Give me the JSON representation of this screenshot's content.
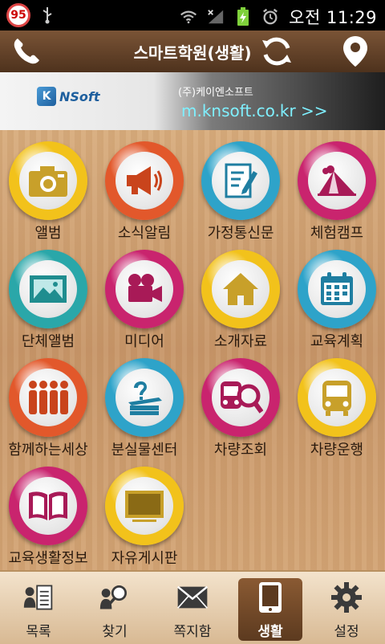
{
  "status_bar": {
    "notification_count": "95",
    "time": "오전 11:29"
  },
  "title_bar": {
    "title": "스마트학원(생활)"
  },
  "banner": {
    "logo_text": "NSoft",
    "company": "(주)케이엔소프트",
    "url": "m.knsoft.co.kr >>"
  },
  "menu": [
    {
      "label": "앨범",
      "ring": "#f2c21b",
      "icon": "camera-icon"
    },
    {
      "label": "소식알림",
      "ring": "#e2582b",
      "icon": "megaphone-icon"
    },
    {
      "label": "가정통신문",
      "ring": "#2ea3c9",
      "icon": "document-edit-icon"
    },
    {
      "label": "체험캠프",
      "ring": "#c9246e",
      "icon": "tent-icon"
    },
    {
      "label": "단체앨범",
      "ring": "#2aa7a9",
      "icon": "picture-icon"
    },
    {
      "label": "미디어",
      "ring": "#c9246e",
      "icon": "video-camera-icon"
    },
    {
      "label": "소개자료",
      "ring": "#f2c21b",
      "icon": "house-icon"
    },
    {
      "label": "교육계획",
      "ring": "#2ea3c9",
      "icon": "calendar-icon"
    },
    {
      "label": "함께하는세상",
      "ring": "#e2582b",
      "icon": "people-icon"
    },
    {
      "label": "분실물센터",
      "ring": "#2ea3c9",
      "icon": "lost-found-icon"
    },
    {
      "label": "차량조회",
      "ring": "#c9246e",
      "icon": "bus-search-icon"
    },
    {
      "label": "차량운행",
      "ring": "#f2c21b",
      "icon": "bus-icon"
    },
    {
      "label": "교육생활정보",
      "ring": "#c9246e",
      "icon": "book-icon"
    },
    {
      "label": "자유게시판",
      "ring": "#f2c21b",
      "icon": "chalkboard-icon"
    }
  ],
  "bottom_nav": [
    {
      "label": "목록",
      "icon": "list-icon",
      "active": false
    },
    {
      "label": "찾기",
      "icon": "search-icon",
      "active": false
    },
    {
      "label": "쪽지함",
      "icon": "mail-icon",
      "active": false
    },
    {
      "label": "생활",
      "icon": "tablet-icon",
      "active": true
    },
    {
      "label": "설정",
      "icon": "gear-icon",
      "active": false
    }
  ]
}
